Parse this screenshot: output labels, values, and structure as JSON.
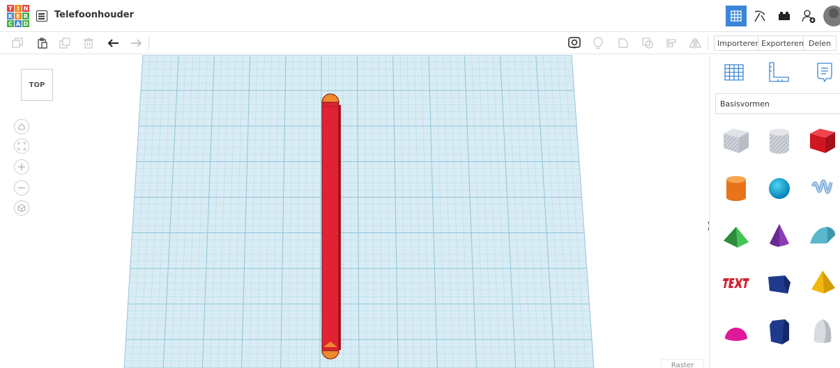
{
  "header": {
    "design_title": "Telefoonhouder",
    "logo_letters": [
      "T",
      "I",
      "N",
      "K",
      "E",
      "R",
      "C",
      "A",
      "D"
    ]
  },
  "toolbar": {
    "import_label": "Importeren",
    "export_label": "Exporteren",
    "share_label": "Delen"
  },
  "workplane": {
    "view_cube_label": "TOP",
    "grid_label": "Raster",
    "accent_color": "#d9ecf4",
    "shape_color": "#e02233"
  },
  "shapes_panel": {
    "category_value": "Basisvormen",
    "shapes": [
      "box-hole",
      "cylinder-hole",
      "box",
      "cylinder",
      "sphere",
      "scribble",
      "roof",
      "cone",
      "round-roof",
      "text",
      "wedge",
      "pyramid",
      "half-sphere",
      "polygon",
      "paraboloid"
    ]
  },
  "colors": {
    "brand_blue": "#3a87d8",
    "grid_blue": "#b7dbe9"
  }
}
